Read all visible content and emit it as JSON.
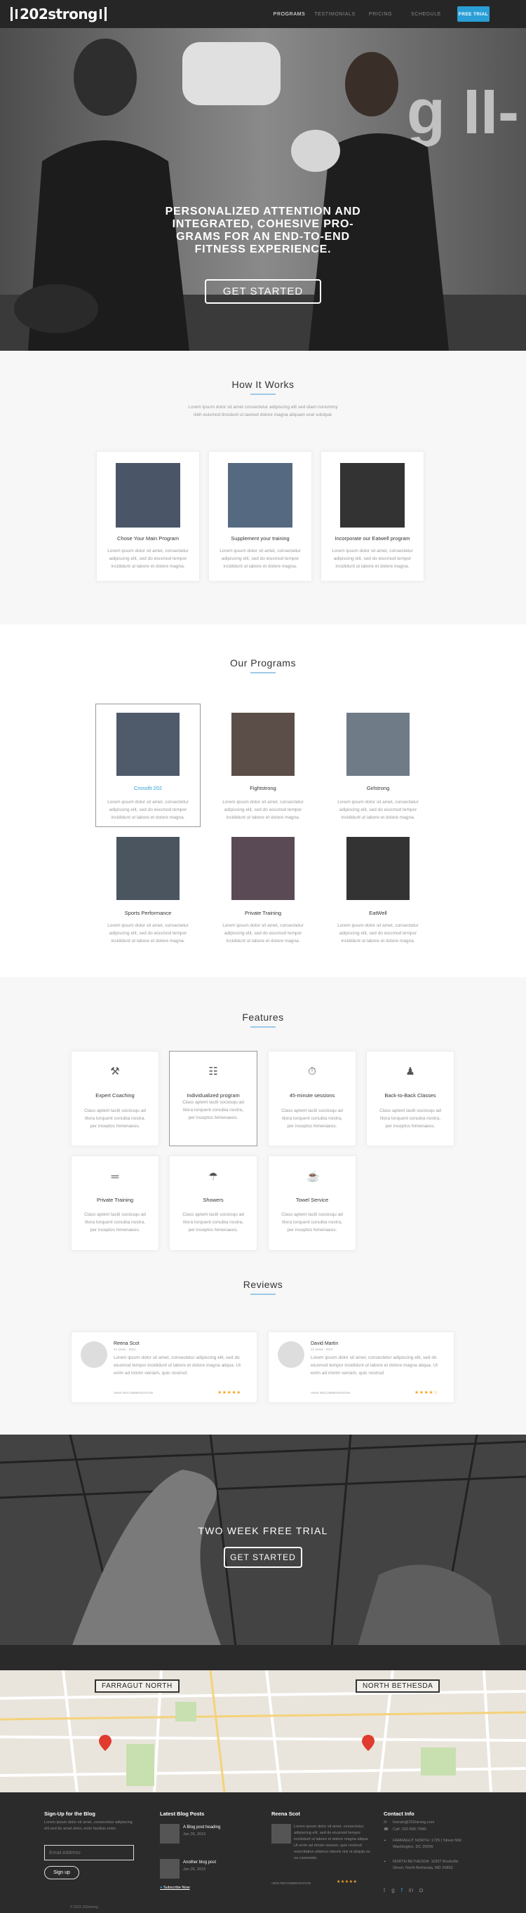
{
  "header": {
    "logo": "202strong",
    "nav": [
      "PROGRAMS",
      "TESTIMONIALS",
      "PRICING",
      "SCHEDULE"
    ],
    "cta": "FREE TRIAL"
  },
  "hero": {
    "title": "PERSONALIZED ATTENTION AND INTEGRATED, COHESIVE PRO-GRAMS FOR AN END-TO-END FITNESS EXPERIENCE.",
    "button": "GET STARTED"
  },
  "how": {
    "title": "How It Works",
    "intro": "Lorem ipsum dolor sit amet consectetur adipiscing elit sed diam nonummy nibh euismod tincidunt ut laoreet dolore magna aliquam erat volutpat.",
    "cards": [
      {
        "title": "Chose Your Main Program",
        "text": "Lorem ipsum dolor sit amet, consectetur adipiscing elit, sed do eiusmod tempor incididunt ut labore et dolore magna."
      },
      {
        "title": "Supplement your training",
        "text": "Lorem ipsum dolor sit amet, consectetur adipiscing elit, sed do eiusmod tempor incididunt ut labore et dolore magna."
      },
      {
        "title": "Incorporate our Eatwell program",
        "text": "Lorem ipsum dolor sit amet, consectetur adipiscing elit, sed do eiusmod tempor incididunt ut labore et dolore magna."
      }
    ]
  },
  "programs": {
    "title": "Our Programs",
    "items": [
      {
        "title": "Crossfit 202",
        "text": "Lorem ipsum dolor sit amet, consectetur adipiscing elit, sed do eiusmod tempor incididunt ut labore et dolore magna."
      },
      {
        "title": "Fightstrong",
        "text": "Lorem ipsum dolor sit amet, consectetur adipiscing elit, sed do eiusmod tempor incididunt ut labore et dolore magna."
      },
      {
        "title": "Girlstrong",
        "text": "Lorem ipsum dolor sit amet, consectetur adipiscing elit, sed do eiusmod tempor incididunt ut labore et dolore magna."
      },
      {
        "title": "Sports Performance",
        "text": "Lorem ipsum dolor sit amet, consectetur adipiscing elit, sed do eiusmod tempor incididunt ut labore et dolore magna."
      },
      {
        "title": "Private Training",
        "text": "Lorem ipsum dolor sit amet, consectetur adipiscing elit, sed do eiusmod tempor incididunt ut labore et dolore magna."
      },
      {
        "title": "EatWell",
        "text": "Lorem ipsum dolor sit amet, consectetur adipiscing elit, sed do eiusmod tempor incididunt ut labore et dolore magna."
      }
    ]
  },
  "features": {
    "title": "Features",
    "items": [
      {
        "title": "Expert Coaching",
        "icon": "whistle-icon",
        "glyph": "⚒",
        "text": "Class aptent taciti sociosqu ad litora torquent conubia nostra, per inceptos himenaeos."
      },
      {
        "title": "Individualized program",
        "icon": "clipboard-icon",
        "glyph": "☷",
        "text": "Class aptent taciti sociosqu ad litora torquent conubia nostra, per inceptos himenaeos."
      },
      {
        "title": "45-minute sessions",
        "icon": "stopwatch-icon",
        "glyph": "⏱",
        "text": "Class aptent taciti sociosqu ad litora torquent conubia nostra, per inceptos himenaeos."
      },
      {
        "title": "Back-to-Back Classes",
        "icon": "kettlebell-icon",
        "glyph": "♟",
        "text": "Class aptent taciti sociosqu ad litora torquent conubia nostra, per inceptos himenaeos."
      },
      {
        "title": "Private Training",
        "icon": "dumbbell-icon",
        "glyph": "═",
        "text": "Class aptent taciti sociosqu ad litora torquent conubia nostra, per inceptos himenaeos."
      },
      {
        "title": "Showers",
        "icon": "shower-icon",
        "glyph": "☂",
        "text": "Class aptent taciti sociosqu ad litora torquent conubia nostra, per inceptos himenaeos."
      },
      {
        "title": "Towel Service",
        "icon": "towel-icon",
        "glyph": "☕",
        "text": "Class aptent taciti sociosqu ad litora torquent conubia nostra, per inceptos himenaeos."
      }
    ]
  },
  "reviews": {
    "title": "Reviews",
    "items": [
      {
        "name": "Reena Scot",
        "meta": "21 views · 2013",
        "text": "Lorem ipsum dolor sit amet, consectetur adipiscing elit, sed do eiusmod tempor incididunt ut labore et dolore magna aliqua. Ut enim ad minim veniam, quis nostrud.",
        "link": "VIEW RECOMMENDATION",
        "rating": 5
      },
      {
        "name": "David Martin",
        "meta": "21 views · 2013",
        "text": "Lorem ipsum dolor sit amet, consectetur adipiscing elit, sed do eiusmod tempor incididunt ut labore et dolore magna aliqua. Ut enim ad minim veniam, quis nostrud.",
        "link": "VIEW RECOMMENDATION",
        "rating": 4
      }
    ]
  },
  "cta": {
    "title": "TWO WEEK FREE TRIAL",
    "button": "GET STARTED"
  },
  "map": {
    "label_left": "FARRAGUT NORTH",
    "label_right": "NORTH BETHESDA"
  },
  "footer": {
    "signup": {
      "title": "Sign-Up for the Blog",
      "text": "Lorem ipsum dolor sit amet, consectetur adipiscing elit sed do amet dolor, enim facilisis enim.",
      "placeholder": "Email Address",
      "button": "Sign up"
    },
    "blog": {
      "title": "Latest Blog Posts",
      "posts": [
        {
          "title": "A Blog post heading",
          "date": "Jan 26, 2015"
        },
        {
          "title": "Another blog post",
          "date": "Jan 26, 2015"
        }
      ],
      "subscribe": "Subscribe Now"
    },
    "review": {
      "title": "Reena Scot",
      "text": "Lorem ipsum dolor sit amet, consectetur adipiscing elit, sed do eiusmod tempor incididunt ut labore et dolore magna aliqua. Ut enim ad minim veniam, quis nostrud exercitation ullamco laboris nisi ut aliquip ex ea commodo.",
      "link": "VIEW RECOMMENDATION"
    },
    "contact": {
      "title": "Contact Info",
      "email": "friends@202strong.com",
      "phone": "Call: 202-506-7949",
      "addr1": "FARRAGUT NORTH: 1725 I Street NW, Washington, DC 20006",
      "addr2": "NORTH BETHESDA: 11837 Rockville Street, North Bethesda, MD 20852"
    },
    "copyright": "© 2015 202strong"
  }
}
